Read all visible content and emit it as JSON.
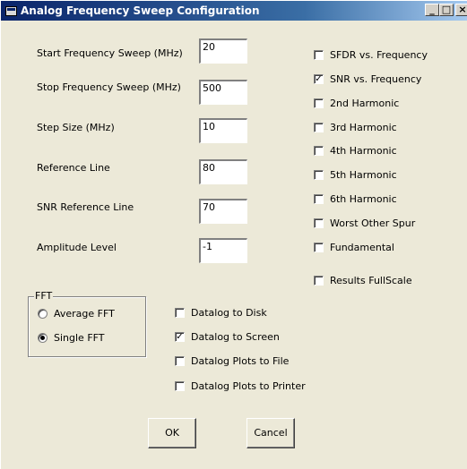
{
  "window": {
    "title": "Analog Frequency Sweep Configuration",
    "controls": {
      "minimize": "_",
      "maximize": "□",
      "close": "×"
    }
  },
  "fields": [
    {
      "label": "Start Frequency Sweep (MHz)",
      "value": "20"
    },
    {
      "label": "Stop Frequency Sweep (MHz)",
      "value": "500"
    },
    {
      "label": "Step Size (MHz)",
      "value": "10"
    },
    {
      "label": "Reference Line",
      "value": "80"
    },
    {
      "label": "SNR Reference Line",
      "value": "70"
    },
    {
      "label": "Amplitude Level",
      "value": "-1"
    }
  ],
  "plots": [
    {
      "label": "SFDR vs. Frequency",
      "checked": false
    },
    {
      "label": "SNR vs. Frequency",
      "checked": true
    },
    {
      "label": "2nd Harmonic",
      "checked": false
    },
    {
      "label": "3rd Harmonic",
      "checked": false
    },
    {
      "label": "4th Harmonic",
      "checked": false
    },
    {
      "label": "5th Harmonic",
      "checked": false
    },
    {
      "label": "6th Harmonic",
      "checked": false
    },
    {
      "label": "Worst Other Spur",
      "checked": false
    },
    {
      "label": "Fundamental",
      "checked": false
    }
  ],
  "results_fullscale": {
    "label": "Results FullScale",
    "checked": false
  },
  "fft": {
    "legend": "FFT",
    "options": [
      {
        "label": "Average FFT",
        "selected": false
      },
      {
        "label": "Single FFT",
        "selected": true
      }
    ]
  },
  "datalog": [
    {
      "label": "Datalog to Disk",
      "checked": false
    },
    {
      "label": "Datalog to Screen",
      "checked": true
    },
    {
      "label": "Datalog Plots to File",
      "checked": false
    },
    {
      "label": "Datalog Plots to Printer",
      "checked": false
    }
  ],
  "buttons": {
    "ok": "OK",
    "cancel": "Cancel"
  }
}
